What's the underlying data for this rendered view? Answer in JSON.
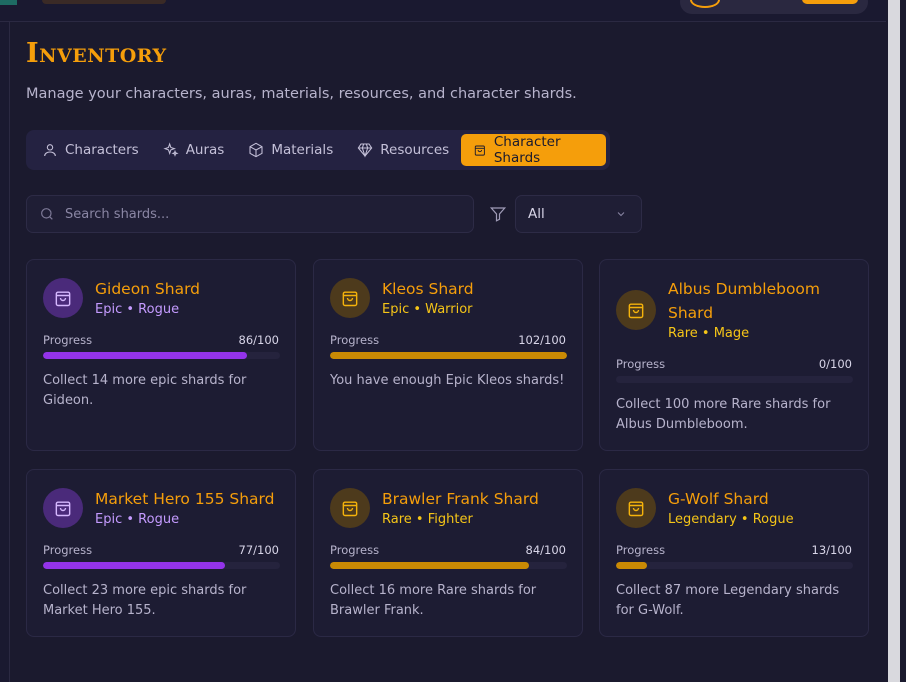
{
  "page": {
    "title": "Inventory",
    "subtitle": "Manage your characters, auras, materials, resources, and character shards."
  },
  "tabs": [
    {
      "label": "Characters",
      "icon": "user-icon",
      "active": false
    },
    {
      "label": "Auras",
      "icon": "sparkles-icon",
      "active": false
    },
    {
      "label": "Materials",
      "icon": "box-icon",
      "active": false
    },
    {
      "label": "Resources",
      "icon": "gem-icon",
      "active": false
    },
    {
      "label": "Character Shards",
      "icon": "shopping-bag-icon",
      "active": true
    }
  ],
  "search": {
    "placeholder": "Search shards...",
    "value": ""
  },
  "filter": {
    "selected": "All"
  },
  "progress_label": "Progress",
  "colors": {
    "accent": "#f59e0b",
    "epic": "#9333ea",
    "gold": "#ca8a04",
    "background": "#1b1a2e"
  },
  "shards": [
    {
      "name": "Gideon Shard",
      "rarity": "Epic",
      "class": "Rogue",
      "progress": "86/100",
      "current": 86,
      "total": 100,
      "message": "Collect 14 more epic shards for Gideon."
    },
    {
      "name": "Kleos Shard",
      "rarity": "Epic",
      "class": "Warrior",
      "progress": "102/100",
      "current": 102,
      "total": 100,
      "message": "You have enough Epic Kleos shards!"
    },
    {
      "name": "Albus Dumbleboom Shard",
      "rarity": "Rare",
      "class": "Mage",
      "progress": "0/100",
      "current": 0,
      "total": 100,
      "message": "Collect 100 more Rare shards for Albus Dumbleboom."
    },
    {
      "name": "Market Hero 155 Shard",
      "rarity": "Epic",
      "class": "Rogue",
      "progress": "77/100",
      "current": 77,
      "total": 100,
      "message": "Collect 23 more epic shards for Market Hero 155."
    },
    {
      "name": "Brawler Frank Shard",
      "rarity": "Rare",
      "class": "Fighter",
      "progress": "84/100",
      "current": 84,
      "total": 100,
      "message": "Collect 16 more Rare shards for Brawler Frank."
    },
    {
      "name": "G-Wolf Shard",
      "rarity": "Legendary",
      "class": "Rogue",
      "progress": "13/100",
      "current": 13,
      "total": 100,
      "message": "Collect 87 more Legendary shards for G-Wolf."
    }
  ]
}
